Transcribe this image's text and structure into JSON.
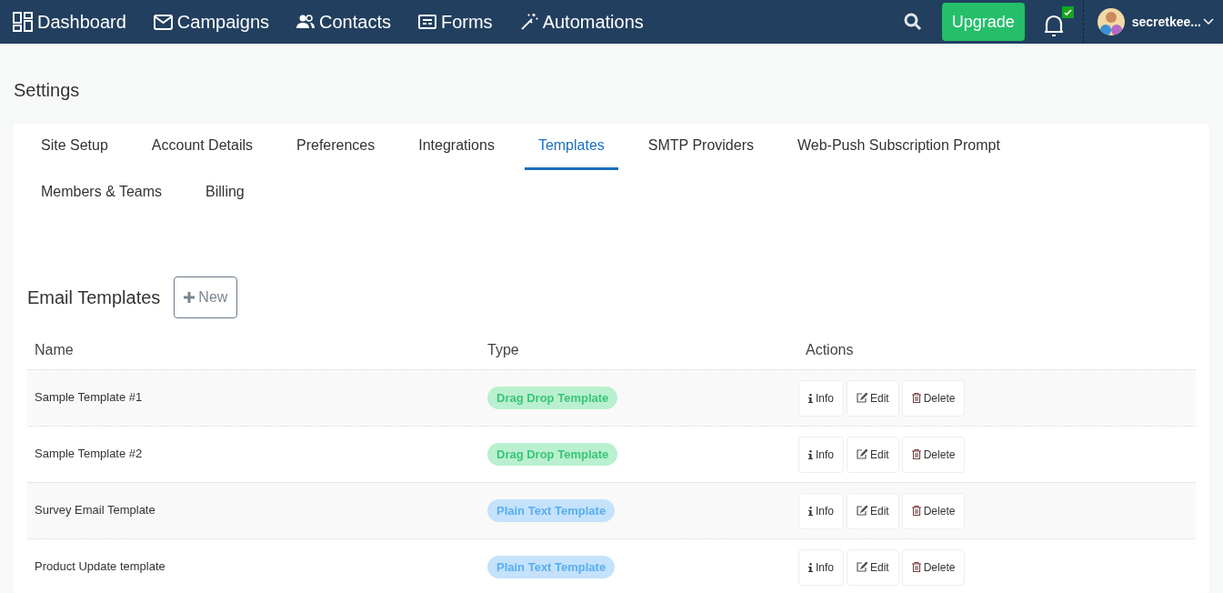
{
  "nav": {
    "items": [
      {
        "kind": "dashboard",
        "label": "Dashboard"
      },
      {
        "kind": "campaigns",
        "label": "Campaigns"
      },
      {
        "kind": "contacts",
        "label": "Contacts"
      },
      {
        "kind": "forms",
        "label": "Forms"
      },
      {
        "kind": "automations",
        "label": "Automations"
      }
    ],
    "upgrade": "Upgrade",
    "user": "secretkee..."
  },
  "page_title": "Settings",
  "tabs": [
    {
      "label": "Site Setup",
      "selected": false
    },
    {
      "label": "Account Details",
      "selected": false
    },
    {
      "label": "Preferences",
      "selected": false
    },
    {
      "label": "Integrations",
      "selected": false
    },
    {
      "label": "Templates",
      "selected": true
    },
    {
      "label": "SMTP Providers",
      "selected": false
    },
    {
      "label": "Web-Push Subscription Prompt",
      "selected": false
    },
    {
      "label": "Members & Teams",
      "selected": false
    },
    {
      "label": "Billing",
      "selected": false
    }
  ],
  "section_title": "Email Templates",
  "new_button": "New",
  "table": {
    "columns": [
      "Name",
      "Type",
      "Actions"
    ],
    "rows": [
      {
        "name": "Sample Template #1",
        "type": {
          "kind": "dragdrop",
          "label": "Drag Drop Template"
        },
        "actions": [
          "Info",
          "Edit",
          "Delete"
        ]
      },
      {
        "name": "Sample Template #2",
        "type": {
          "kind": "dragdrop",
          "label": "Drag Drop Template"
        },
        "actions": [
          "Info",
          "Edit",
          "Delete"
        ]
      },
      {
        "name": "Survey Email Template",
        "type": {
          "kind": "plaintext",
          "label": "Plain Text Template"
        },
        "actions": [
          "Info",
          "Edit",
          "Delete"
        ]
      },
      {
        "name": "Product Update template",
        "type": {
          "kind": "plaintext",
          "label": "Plain Text Template"
        },
        "actions": [
          "Info",
          "Edit",
          "Delete"
        ]
      }
    ]
  }
}
